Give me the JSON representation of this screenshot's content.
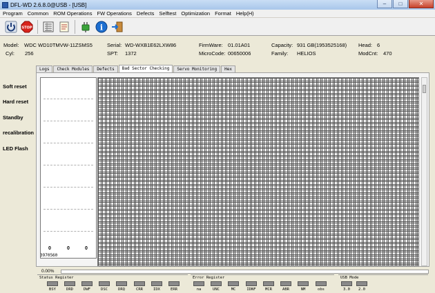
{
  "window": {
    "title": "DFL-WD 2.6.8.0@USB - [USB]"
  },
  "menu": [
    "Program",
    "Common",
    "ROM Operations",
    "FW Operations",
    "Defects",
    "Selftest",
    "Optimization",
    "Format",
    "Help(H)"
  ],
  "toolbar": {
    "icons": [
      "power-icon",
      "stop-icon",
      "list-icon",
      "notepad-icon",
      "plug-icon",
      "info-icon",
      "exit-icon"
    ]
  },
  "drive": {
    "model_label": "Model:",
    "model": "WDC WD10TMVW-11ZSMS5",
    "serial_label": "Serial:",
    "serial": "WD-WXB1E62LXW86",
    "firmware_label": "FirmWare:",
    "firmware": "01.01A01",
    "capacity_label": "Capacity:",
    "capacity": "931 GB(1953525168)",
    "head_label": "Head:",
    "head": "6",
    "cyl_label": "Cyl:",
    "cyl": "256",
    "spt_label": "SPT:",
    "spt": "1372",
    "microcode_label": "MicroCode:",
    "microcode": "00650006",
    "family_label": "Family:",
    "family": "HELIOS",
    "modcnt_label": "ModCnt:",
    "modcnt": "470"
  },
  "tabs": [
    "Logs",
    "Check Modules",
    "Defects",
    "Bad Sector Checking",
    "Servo Monitoring",
    "Hex"
  ],
  "active_tab": "Bad Sector Checking",
  "side_buttons": [
    "Soft reset",
    "Hard reset",
    "Standby",
    "recalibration",
    "LED Flash"
  ],
  "legend_counts": [
    "0",
    "0",
    "0"
  ],
  "address": "3970560",
  "progress": {
    "text": "0.00%",
    "value": 0
  },
  "status_register": {
    "title": "Status Register",
    "bits": [
      "BSY",
      "DRD",
      "DWF",
      "DSC",
      "DRQ",
      "CRR",
      "IDX",
      "ERR"
    ]
  },
  "error_register": {
    "title": "Error Register",
    "bits": [
      "na",
      "UNC",
      "MC",
      "IDNF",
      "MCR",
      "ABR",
      "NM",
      "obs"
    ]
  },
  "usb_mode": {
    "title": "USB Mode",
    "modes": [
      "3.0",
      "2.0"
    ]
  },
  "colors": {
    "led_off": "#8a8a8a",
    "progress_fill": "#3b9b3b"
  }
}
